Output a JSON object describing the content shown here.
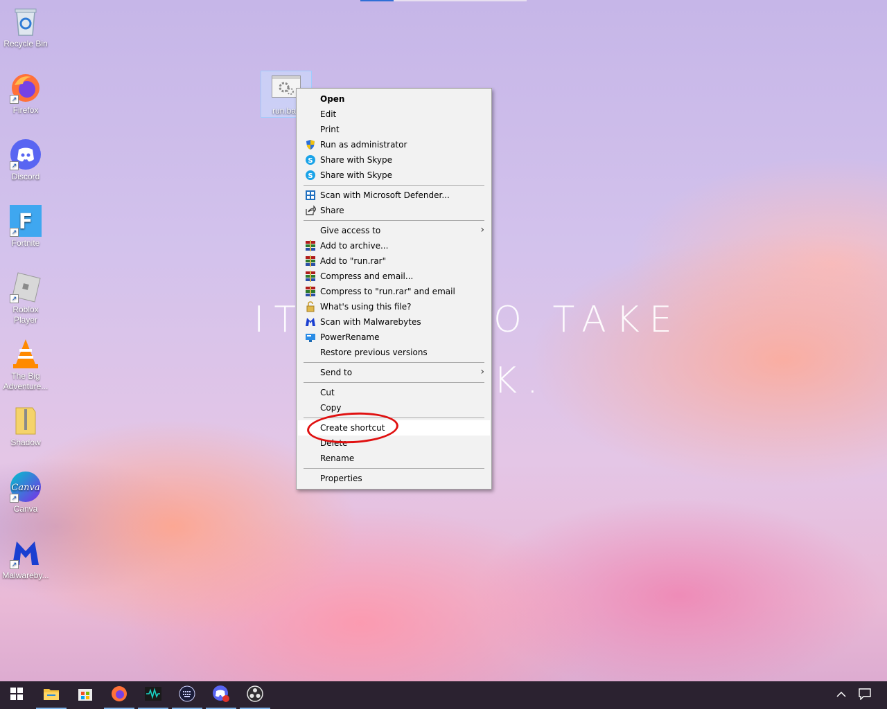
{
  "desktop": {
    "icons": [
      {
        "label": "Recycle Bin"
      },
      {
        "label": "Firefox"
      },
      {
        "label": "Discord"
      },
      {
        "label": "Fortnite"
      },
      {
        "label": "Roblox\nPlayer",
        "line1": "Roblox",
        "line2": "Player"
      },
      {
        "label": "The Big Adventure...",
        "line1": "The Big",
        "line2": "Adventure..."
      },
      {
        "label": "Shadow"
      },
      {
        "label": "Canva"
      },
      {
        "label": "Malwareby..."
      }
    ],
    "selected_file_label": "run.ba",
    "wallpaper_text_left": "IT",
    "wallpaper_text_right": "O TAKE",
    "wallpaper_text_line2": "K."
  },
  "context_menu": {
    "items": [
      {
        "label": "Open"
      },
      {
        "label": "Edit"
      },
      {
        "label": "Print"
      },
      {
        "label": "Run as administrator"
      },
      {
        "label": "Share with Skype"
      },
      {
        "label": "Share with Skype"
      },
      {
        "label": "Scan with Microsoft Defender..."
      },
      {
        "label": "Share"
      },
      {
        "label": "Give access to"
      },
      {
        "label": "Add to archive..."
      },
      {
        "label": "Add to \"run.rar\""
      },
      {
        "label": "Compress and email..."
      },
      {
        "label": "Compress to \"run.rar\" and email"
      },
      {
        "label": "What's using this file?"
      },
      {
        "label": "Scan with Malwarebytes"
      },
      {
        "label": "PowerRename"
      },
      {
        "label": "Restore previous versions"
      },
      {
        "label": "Send to"
      },
      {
        "label": "Cut"
      },
      {
        "label": "Copy"
      },
      {
        "label": "Create shortcut"
      },
      {
        "label": "Delete"
      },
      {
        "label": "Rename"
      },
      {
        "label": "Properties"
      }
    ],
    "highlighted": "Create shortcut"
  },
  "colors": {
    "annotation_circle": "#e01010",
    "taskbar": "#2b2230",
    "menu_bg": "#f2f2f2"
  },
  "taskbar": {
    "icons": [
      "windows-start-icon",
      "file-explorer-icon",
      "microsoft-store-icon",
      "firefox-icon",
      "waveform-app-icon",
      "keypad-app-icon",
      "discord-icon",
      "obs-icon",
      "chevron-up-icon",
      "notification-icon"
    ]
  }
}
